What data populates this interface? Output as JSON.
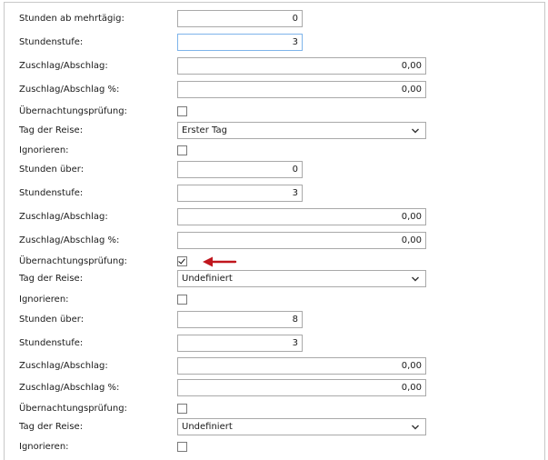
{
  "rows": [
    {
      "label": "Stunden ab mehrtägig:",
      "value": "0"
    },
    {
      "label": "Stundenstufe:",
      "value": "3"
    },
    {
      "label": "Zuschlag/Abschlag:",
      "value": "0,00"
    },
    {
      "label": "Zuschlag/Abschlag %:",
      "value": "0,00"
    },
    {
      "label": "Übernachtungsprüfung:",
      "checked": false
    },
    {
      "label": "Tag der Reise:",
      "value": "Erster Tag"
    },
    {
      "label": "Ignorieren:",
      "checked": false
    },
    {
      "label": "Stunden über:",
      "value": "0"
    },
    {
      "label": "Stundenstufe:",
      "value": "3"
    },
    {
      "label": "Zuschlag/Abschlag:",
      "value": "0,00"
    },
    {
      "label": "Zuschlag/Abschlag %:",
      "value": "0,00"
    },
    {
      "label": "Übernachtungsprüfung:",
      "checked": true
    },
    {
      "label": "Tag der Reise:",
      "value": "Undefiniert"
    },
    {
      "label": "Ignorieren:",
      "checked": false
    },
    {
      "label": "Stunden über:",
      "value": "8"
    },
    {
      "label": "Stundenstufe:",
      "value": "3"
    },
    {
      "label": "Zuschlag/Abschlag:",
      "value": "0,00"
    },
    {
      "label": "Zuschlag/Abschlag %:",
      "value": "0,00"
    },
    {
      "label": "Übernachtungsprüfung:",
      "checked": false
    },
    {
      "label": "Tag der Reise:",
      "value": "Undefiniert"
    },
    {
      "label": "Ignorieren:",
      "checked": false
    }
  ],
  "colors": {
    "annotation_arrow": "#c0161d",
    "focus_border": "#7eb4ea"
  },
  "icons": {
    "dropdown": "chevron-down-icon",
    "annotation": "red-arrow-icon"
  }
}
